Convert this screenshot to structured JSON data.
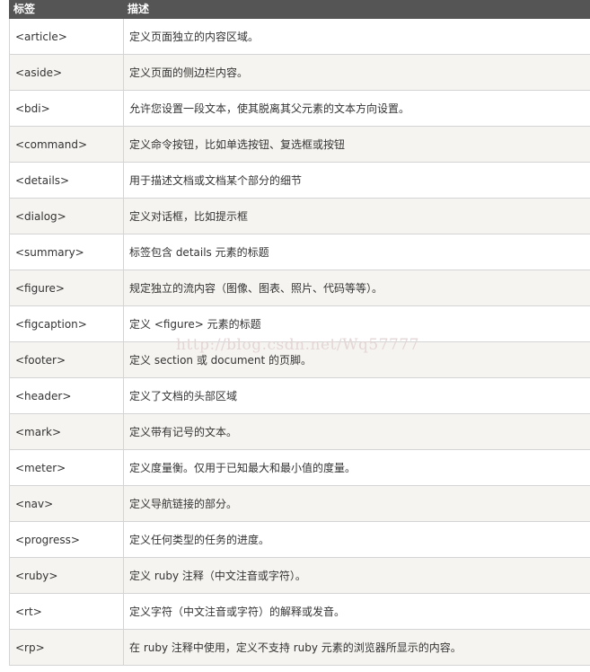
{
  "table": {
    "headers": {
      "tag": "标签",
      "description": "描述"
    },
    "rows": [
      {
        "tag": "<article>",
        "description": "定义页面独立的内容区域。"
      },
      {
        "tag": "<aside>",
        "description": "定义页面的侧边栏内容。"
      },
      {
        "tag": "<bdi>",
        "description": "允许您设置一段文本，使其脱离其父元素的文本方向设置。"
      },
      {
        "tag": "<command>",
        "description": "定义命令按钮，比如单选按钮、复选框或按钮"
      },
      {
        "tag": "<details>",
        "description": "用于描述文档或文档某个部分的细节"
      },
      {
        "tag": "<dialog>",
        "description": "定义对话框，比如提示框"
      },
      {
        "tag": "<summary>",
        "description": "标签包含 details 元素的标题"
      },
      {
        "tag": "<figure>",
        "description": "规定独立的流内容（图像、图表、照片、代码等等）。"
      },
      {
        "tag": "<figcaption>",
        "description": "定义 <figure> 元素的标题"
      },
      {
        "tag": "<footer>",
        "description": "定义 section 或 document 的页脚。"
      },
      {
        "tag": "<header>",
        "description": "定义了文档的头部区域"
      },
      {
        "tag": "<mark>",
        "description": "定义带有记号的文本。"
      },
      {
        "tag": "<meter>",
        "description": "定义度量衡。仅用于已知最大和最小值的度量。"
      },
      {
        "tag": "<nav>",
        "description": "定义导航链接的部分。"
      },
      {
        "tag": "<progress>",
        "description": "定义任何类型的任务的进度。"
      },
      {
        "tag": "<ruby>",
        "description": "定义 ruby 注释（中文注音或字符）。"
      },
      {
        "tag": "<rt>",
        "description": "定义字符（中文注音或字符）的解释或发音。"
      },
      {
        "tag": "<rp>",
        "description": "在 ruby 注释中使用，定义不支持 ruby 元素的浏览器所显示的内容。"
      }
    ]
  },
  "watermark": "http://blog.csdn.net/Wq57777"
}
